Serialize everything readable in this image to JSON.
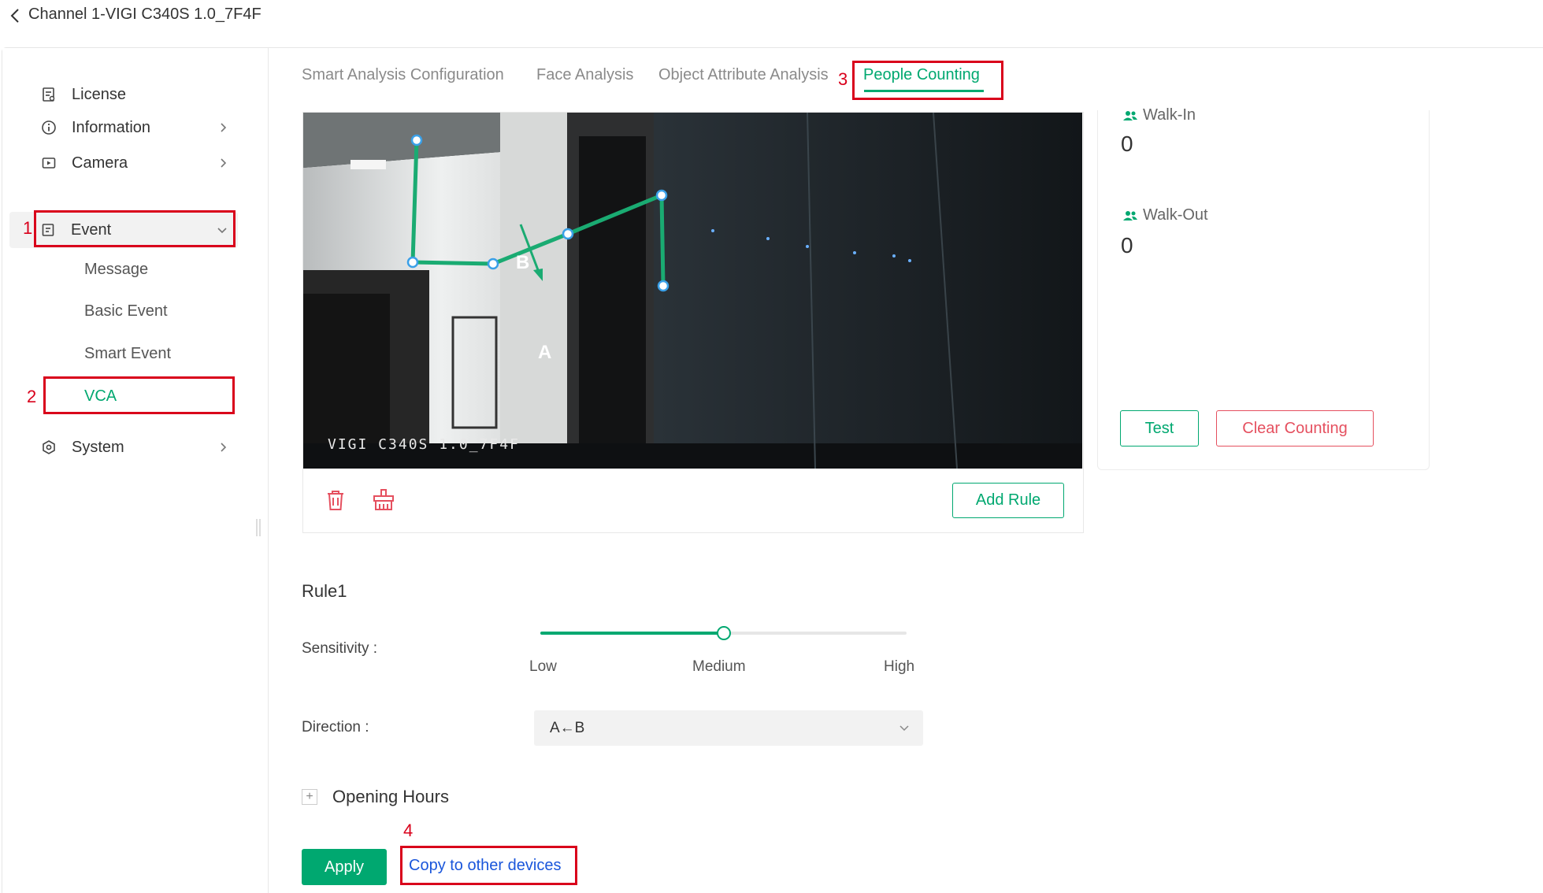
{
  "header": {
    "title": "Channel 1-VIGI C340S 1.0_7F4F"
  },
  "sidebar": {
    "items": [
      {
        "label": "License",
        "icon": "license-icon"
      },
      {
        "label": "Information",
        "icon": "info-icon"
      },
      {
        "label": "Camera",
        "icon": "camera-icon"
      },
      {
        "label": "Event",
        "icon": "event-icon"
      },
      {
        "label": "System",
        "icon": "system-icon"
      }
    ],
    "event_subitems": [
      "Message",
      "Basic Event",
      "Smart Event",
      "VCA"
    ]
  },
  "tabs": [
    {
      "label": "Smart Analysis Configuration"
    },
    {
      "label": "Face Analysis"
    },
    {
      "label": "Object Attribute Analysis"
    },
    {
      "label": "People Counting"
    }
  ],
  "annotations": {
    "n1": "1",
    "n2": "2",
    "n3": "3",
    "n4": "4",
    "accent_red": "#d9001b"
  },
  "video": {
    "osd_text": "VIGI C340S 1.0_7F4F",
    "point_a": "A",
    "point_b": "B",
    "add_rule_label": "Add Rule"
  },
  "counting": {
    "walk_in_label": "Walk-In",
    "walk_in_value": "0",
    "walk_out_label": "Walk-Out",
    "walk_out_value": "0",
    "test_label": "Test",
    "clear_label": "Clear Counting"
  },
  "rule": {
    "title": "Rule1",
    "sensitivity_label": "Sensitivity :",
    "sensitivity_levels": [
      "Low",
      "Medium",
      "High"
    ],
    "sensitivity_value": 0.5,
    "direction_label": "Direction :",
    "direction_value": "A←B",
    "opening_hours_label": "Opening Hours",
    "opening_toggle": "+"
  },
  "footer": {
    "apply_label": "Apply",
    "copy_label": "Copy to other devices"
  },
  "colors": {
    "accent": "#00a870",
    "danger": "#e5505f",
    "link": "#1a56db"
  }
}
